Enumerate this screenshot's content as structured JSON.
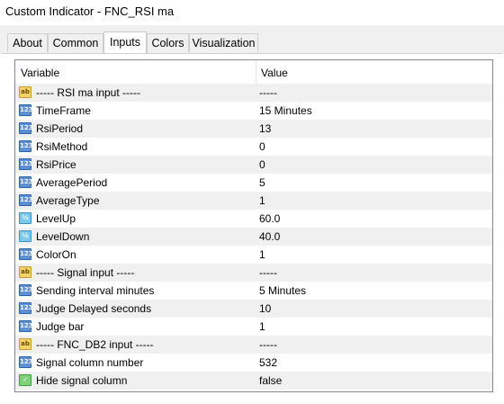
{
  "window": {
    "title": "Custom Indicator - FNC_RSI ma"
  },
  "tabs": [
    {
      "label": "About",
      "active": false
    },
    {
      "label": "Common",
      "active": false
    },
    {
      "label": "Inputs",
      "active": true
    },
    {
      "label": "Colors",
      "active": false
    },
    {
      "label": "Visualization",
      "active": false
    }
  ],
  "grid": {
    "headers": {
      "variable": "Variable",
      "value": "Value"
    },
    "rows": [
      {
        "icon": "string-icon",
        "name": "----- RSI ma input -----",
        "value": "-----"
      },
      {
        "icon": "integer-icon",
        "name": "TimeFrame",
        "value": "15 Minutes"
      },
      {
        "icon": "integer-icon",
        "name": "RsiPeriod",
        "value": "13"
      },
      {
        "icon": "integer-icon",
        "name": "RsiMethod",
        "value": "0"
      },
      {
        "icon": "integer-icon",
        "name": "RsiPrice",
        "value": "0"
      },
      {
        "icon": "integer-icon",
        "name": "AveragePeriod",
        "value": "5"
      },
      {
        "icon": "integer-icon",
        "name": "AverageType",
        "value": "1"
      },
      {
        "icon": "double-icon",
        "name": "LevelUp",
        "value": "60.0"
      },
      {
        "icon": "double-icon",
        "name": "LevelDown",
        "value": "40.0"
      },
      {
        "icon": "integer-icon",
        "name": "ColorOn",
        "value": "1"
      },
      {
        "icon": "string-icon",
        "name": "----- Signal input -----",
        "value": "-----"
      },
      {
        "icon": "integer-icon",
        "name": "Sending interval minutes",
        "value": "5 Minutes"
      },
      {
        "icon": "integer-icon",
        "name": "Judge Delayed seconds",
        "value": "10"
      },
      {
        "icon": "integer-icon",
        "name": "Judge bar",
        "value": "1"
      },
      {
        "icon": "string-icon",
        "name": "----- FNC_DB2 input -----",
        "value": "-----"
      },
      {
        "icon": "integer-icon",
        "name": "Signal column number",
        "value": "532"
      },
      {
        "icon": "bool-icon",
        "name": "Hide signal column",
        "value": "false"
      }
    ]
  },
  "colors": {
    "alt_row": "#f0f0f0",
    "row": "#ffffff",
    "grid_border": "#828790"
  }
}
